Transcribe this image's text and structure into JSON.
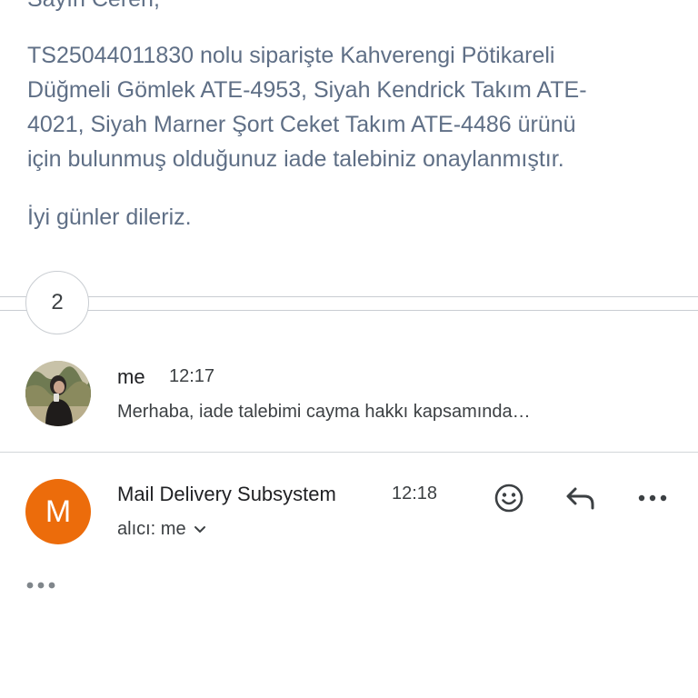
{
  "message_body": {
    "greeting": "Sayın Ceren,",
    "paragraph_lines": [
      "TS25044011830 nolu siparişte Kahverengi Pötikareli",
      "Düğmeli Gömlek ATE-4953, Siyah Kendrick Takım ATE-",
      "4021, Siyah Marner Şort Ceket Takım ATE-4486 ürünü",
      "için bulunmuş olduğunuz iade talebiniz onaylanmıştır."
    ],
    "closing": "İyi günler dileriz."
  },
  "collapsed": {
    "count": "2"
  },
  "messages": [
    {
      "sender": "me",
      "time": "12:17",
      "snippet": "Merhaba, iade talebimi cayma hakkı kapsamında…",
      "avatar": "profile-photo"
    },
    {
      "sender": "Mail Delivery Subsystem",
      "time": "12:18",
      "recipient": "alıcı: me",
      "avatar_letter": "M",
      "avatar_color": "#ec6c0b"
    }
  ],
  "colors": {
    "body_text": "#5f6f86",
    "divider": "#c9cdd2",
    "avatar_orange": "#ec6c0b"
  },
  "icons": {
    "emoji": "smiley-face-icon",
    "reply": "reply-arrow-icon",
    "more": "more-horizontal-icon",
    "expand": "chevron-down-icon",
    "trimmed": "trimmed-content-dots-icon"
  }
}
